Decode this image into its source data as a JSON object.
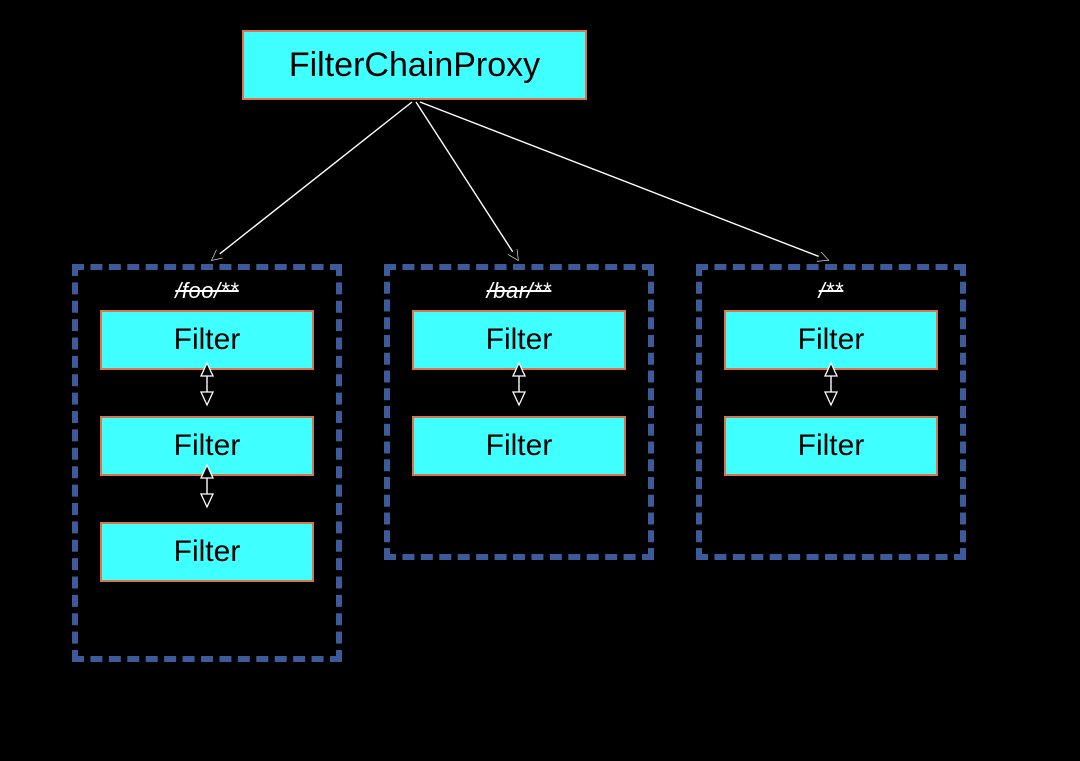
{
  "proxy": {
    "label": "FilterChainProxy"
  },
  "chains": [
    {
      "title": "/foo/**",
      "filters": [
        "Filter",
        "Filter",
        "Filter"
      ]
    },
    {
      "title": "/bar/**",
      "filters": [
        "Filter",
        "Filter"
      ]
    },
    {
      "title": "/**",
      "filters": [
        "Filter",
        "Filter"
      ]
    }
  ],
  "colors": {
    "box_fill": "#40ffff",
    "box_border": "#d8754a",
    "dashed_border": "#3d5a9a",
    "background": "#000000"
  }
}
